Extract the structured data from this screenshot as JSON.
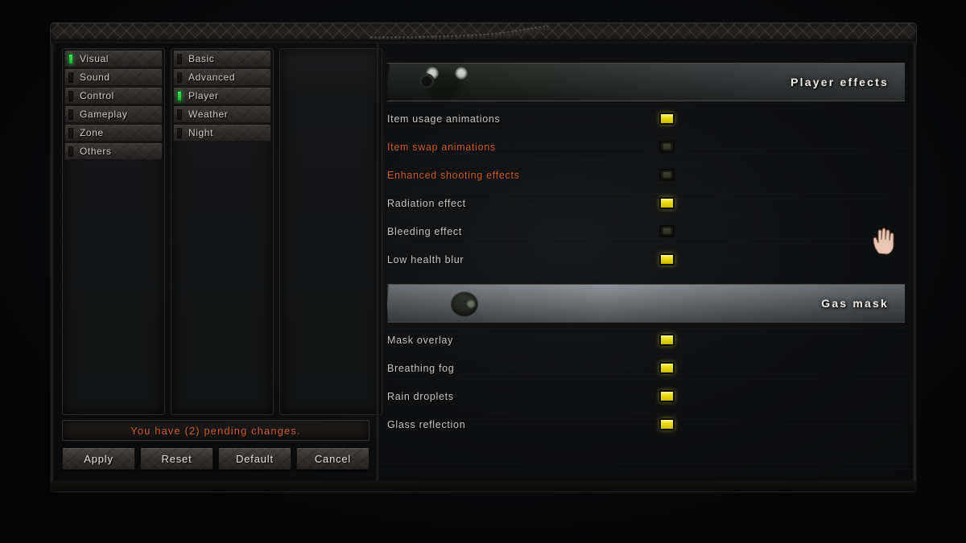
{
  "window": {
    "nav_columns": [
      {
        "name": "category-column",
        "items": [
          {
            "label": "Visual",
            "active": true
          },
          {
            "label": "Sound",
            "active": false
          },
          {
            "label": "Control",
            "active": false
          },
          {
            "label": "Gameplay",
            "active": false
          },
          {
            "label": "Zone",
            "active": false
          },
          {
            "label": "Others",
            "active": false
          }
        ]
      },
      {
        "name": "subcategory-column",
        "items": [
          {
            "label": "Basic",
            "active": false
          },
          {
            "label": "Advanced",
            "active": false
          },
          {
            "label": "Player",
            "active": true
          },
          {
            "label": "Weather",
            "active": false
          },
          {
            "label": "Night",
            "active": false
          }
        ]
      },
      {
        "name": "detail-column",
        "items": []
      }
    ],
    "status": {
      "pending_text": "You have (2) pending changes."
    },
    "buttons": [
      {
        "label": "Apply"
      },
      {
        "label": "Reset"
      },
      {
        "label": "Default"
      },
      {
        "label": "Cancel"
      }
    ]
  },
  "sections": [
    {
      "title": "Player effects",
      "banner": "gas-mask-forest-banner",
      "options": [
        {
          "label": "Item usage animations",
          "checked": true,
          "modified": false
        },
        {
          "label": "Item swap animations",
          "checked": false,
          "modified": true
        },
        {
          "label": "Enhanced shooting effects",
          "checked": false,
          "modified": true
        },
        {
          "label": "Radiation effect",
          "checked": true,
          "modified": false
        },
        {
          "label": "Bleeding effect",
          "checked": false,
          "modified": false
        },
        {
          "label": "Low health blur",
          "checked": true,
          "modified": false
        }
      ]
    },
    {
      "title": "Gas mask",
      "banner": "stalker-winter-banner",
      "options": [
        {
          "label": "Mask overlay",
          "checked": true,
          "modified": false
        },
        {
          "label": "Breathing fog",
          "checked": true,
          "modified": false
        },
        {
          "label": "Rain droplets",
          "checked": true,
          "modified": false
        },
        {
          "label": "Glass reflection",
          "checked": true,
          "modified": false
        }
      ]
    }
  ],
  "colors": {
    "accent_green": "#3ceb5a",
    "modified_orange": "#cf5f26",
    "checkbox_on": "#e8d916",
    "text": "#cbc7c0"
  },
  "cursor": {
    "icon": "hand-cursor"
  }
}
